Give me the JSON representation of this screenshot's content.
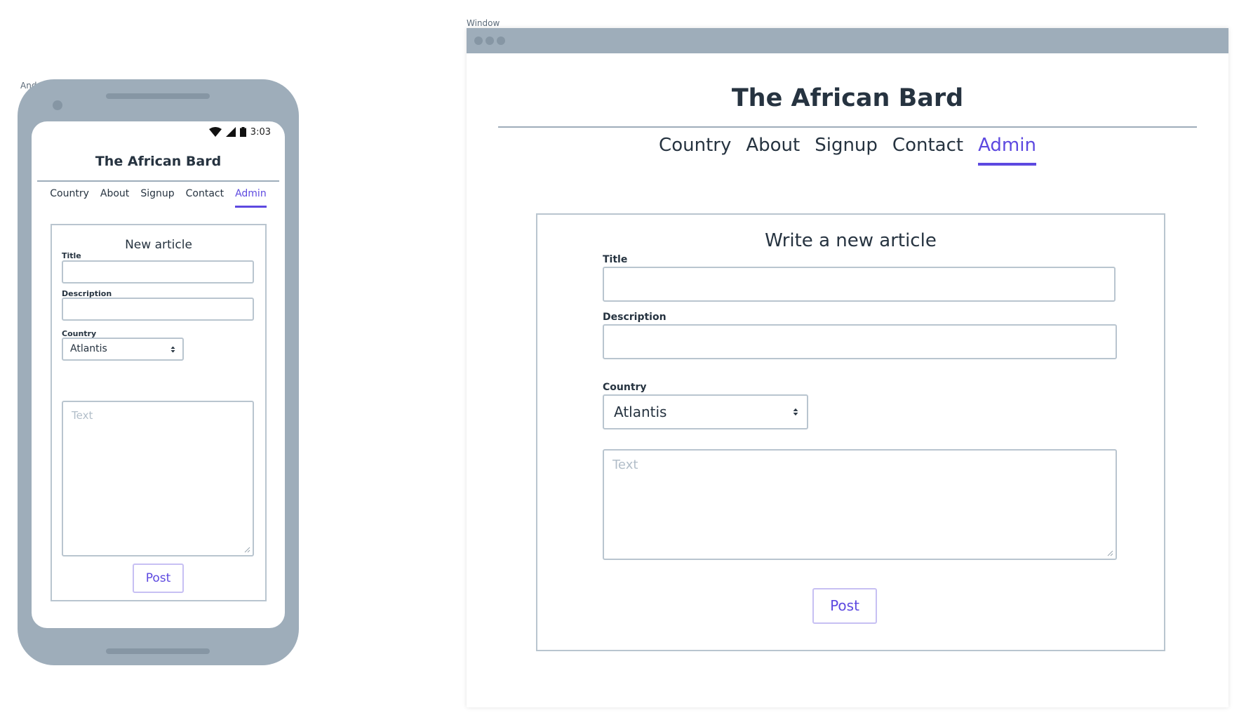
{
  "frames": {
    "android_label": "Android",
    "window_label": "Window"
  },
  "mobile": {
    "status": {
      "time": "3:03",
      "icons": [
        "wifi-icon",
        "signal-icon",
        "battery-icon"
      ]
    },
    "site_title": "The African Bard",
    "nav": [
      {
        "label": "Country",
        "active": false
      },
      {
        "label": "About",
        "active": false
      },
      {
        "label": "Signup",
        "active": false
      },
      {
        "label": "Contact",
        "active": false
      },
      {
        "label": "Admin",
        "active": true
      }
    ],
    "form": {
      "heading": "New article",
      "title_label": "Title",
      "title_value": "",
      "description_label": "Description",
      "description_value": "",
      "country_label": "Country",
      "country_selected": "Atlantis",
      "text_placeholder": "Text",
      "post_label": "Post"
    }
  },
  "desktop": {
    "site_title": "The African Bard",
    "nav": [
      {
        "label": "Country",
        "active": false
      },
      {
        "label": "About",
        "active": false
      },
      {
        "label": "Signup",
        "active": false
      },
      {
        "label": "Contact",
        "active": false
      },
      {
        "label": "Admin",
        "active": true
      }
    ],
    "form": {
      "heading": "Write a new article",
      "title_label": "Title",
      "title_value": "",
      "description_label": "Description",
      "description_value": "",
      "country_label": "Country",
      "country_selected": "Atlantis",
      "text_placeholder": "Text",
      "post_label": "Post"
    }
  },
  "colors": {
    "accent": "#5d49e0",
    "frame_gray": "#9eadba",
    "border": "#b9c5cf",
    "text_dark": "#263340",
    "placeholder": "#b2bec9"
  }
}
